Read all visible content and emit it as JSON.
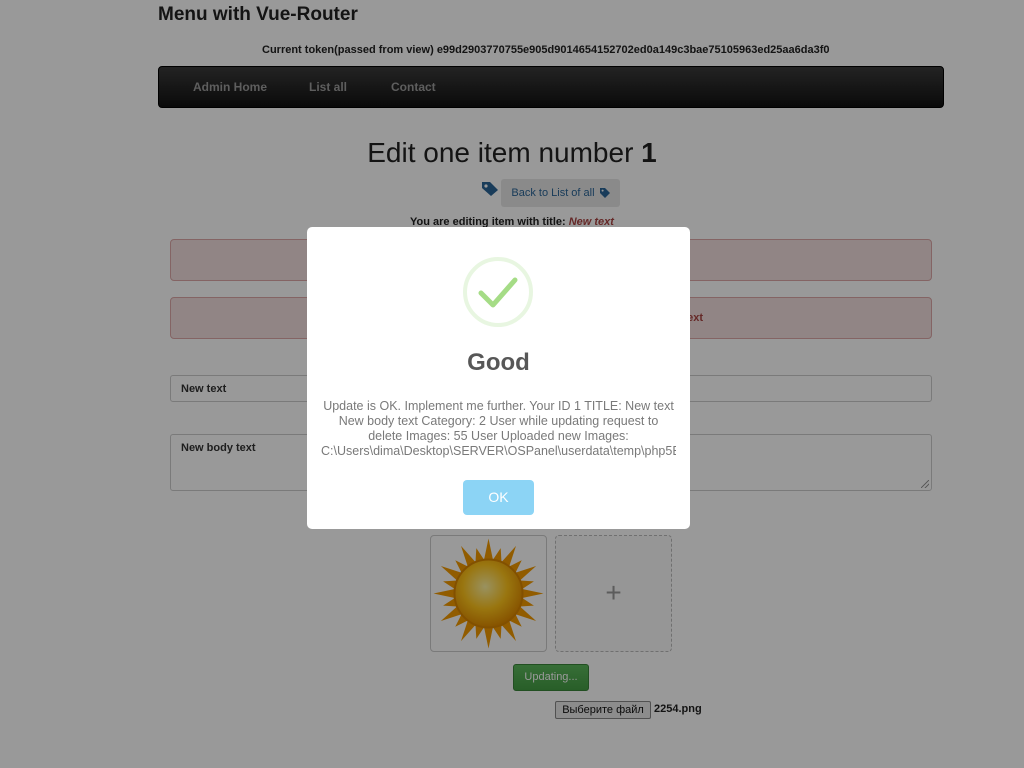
{
  "app": {
    "title": "Menu with Vue-Router",
    "token_line": "Current token(passed from view) e99d2903770755e905d9014654152702ed0a149c3bae75105963ed25aa6da3f0"
  },
  "nav": {
    "items": [
      {
        "label": "Admin Home"
      },
      {
        "label": "List all"
      },
      {
        "label": "Contact"
      }
    ]
  },
  "edit": {
    "heading_prefix": "Edit one item number",
    "item_number": "1",
    "back_button": "Back to List of all",
    "editing_prefix": "You are editing item with title:",
    "editing_title": "New text",
    "alert_partial": "ext",
    "title_value": "New text",
    "body_value": "New body text",
    "update_button": "Updating...",
    "file_button": "Выберите файл",
    "file_name": "2254.png"
  },
  "modal": {
    "title": "Good",
    "text": "Update is OK. Implement me further. Your ID 1 TITLE: New text New body text Category: 2 User while updating request to delete Images: 55 User Uploaded new Images: C:\\Users\\dima\\Desktop\\SERVER\\OSPanel\\userdata\\temp\\php5E",
    "ok_button": "OK"
  },
  "colors": {
    "navbar": "#222222",
    "link": "#2a6496",
    "alert_bg": "#f2dede",
    "alert_text": "#a94442",
    "success_green": "#a5dc86",
    "ok_button": "#8cd4f5",
    "update_button": "#5cb85c"
  },
  "icons": {
    "tag": "tag-icon",
    "check": "checkmark-icon",
    "plus": "plus-icon",
    "image": "sun-image"
  }
}
